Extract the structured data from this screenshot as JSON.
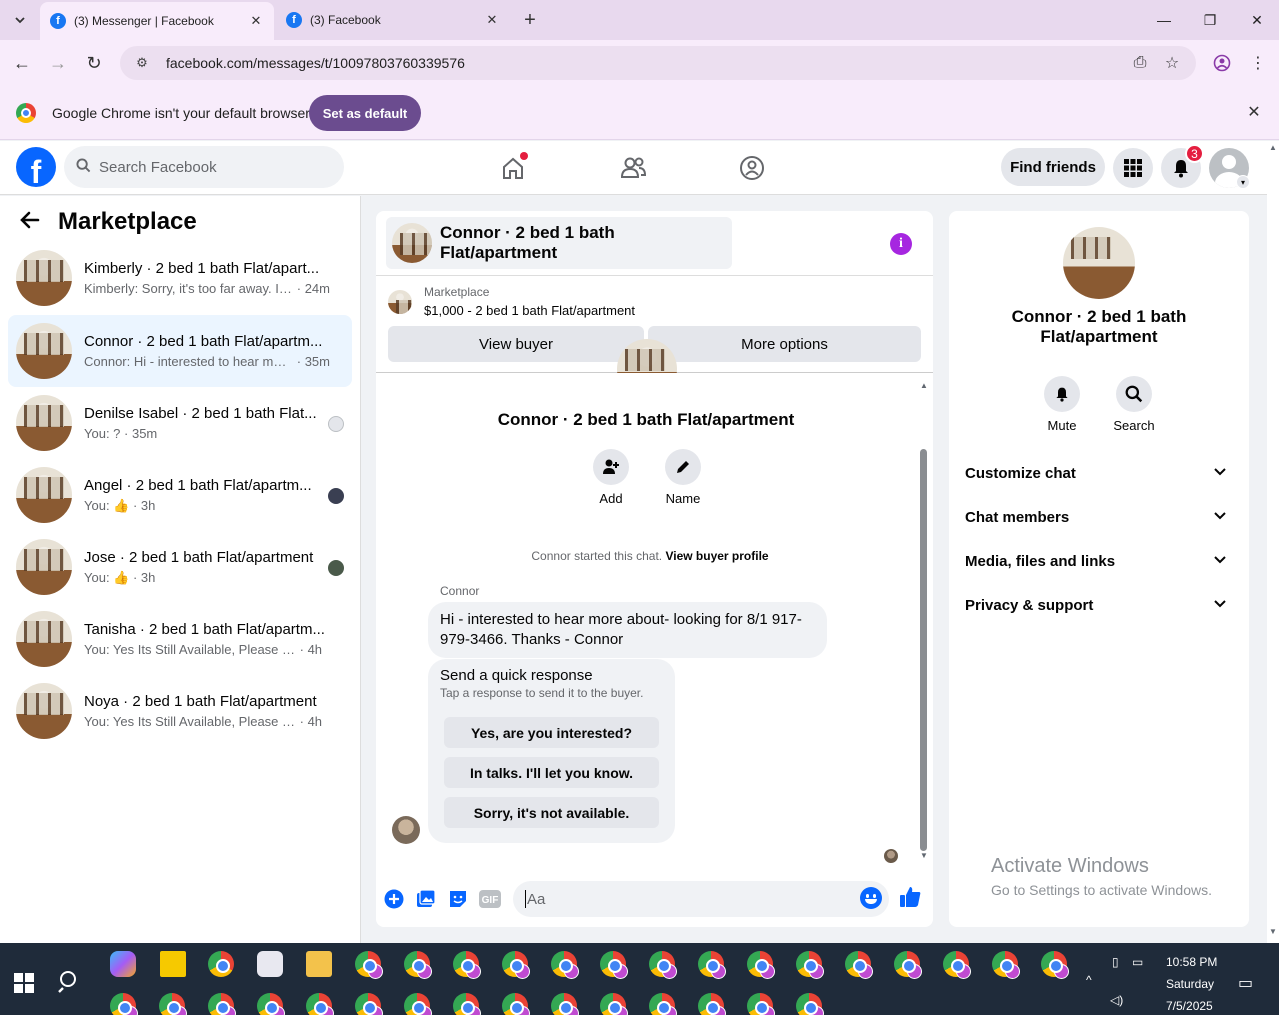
{
  "browser": {
    "tabs": [
      {
        "title": "(3) Messenger | Facebook",
        "favicon": "f"
      },
      {
        "title": "(3) Facebook",
        "favicon": "f"
      }
    ],
    "url": "facebook.com/messages/t/10097803760339576",
    "infobar": {
      "text": "Google Chrome isn't your default browser",
      "button": "Set as default"
    }
  },
  "facebook": {
    "logo": "f",
    "search_placeholder": "Search Facebook",
    "find_friends": "Find friends",
    "notification_count": "3"
  },
  "sidebar": {
    "title": "Marketplace",
    "conversations": [
      {
        "name": "Kimberly · 2 bed 1 bath Flat/apart...",
        "preview": "Kimberly: Sorry, it's too far away. I w...",
        "time": "· 24m",
        "selected": false
      },
      {
        "name": "Connor · 2 bed 1 bath Flat/apartm...",
        "preview": "Connor: Hi - interested to hear mor...",
        "time": "· 35m",
        "selected": true
      },
      {
        "name": "Denilse Isabel · 2 bed 1 bath Flat...",
        "preview": "You: ? ·",
        "time": "35m",
        "selected": false
      },
      {
        "name": "Angel · 2 bed 1 bath Flat/apartm...",
        "preview": "You: 👍",
        "time": "· 3h",
        "selected": false
      },
      {
        "name": "Jose · 2 bed 1 bath Flat/apartment",
        "preview": "You: 👍",
        "time": "· 3h",
        "selected": false
      },
      {
        "name": "Tanisha · 2 bed 1 bath Flat/apartm...",
        "preview": "You: Yes Its Still Available, Please Send...",
        "time": "· 4h",
        "selected": false
      },
      {
        "name": "Noya · 2 bed 1 bath Flat/apartment",
        "preview": "You: Yes Its Still Available, Please Send...",
        "time": "· 4h",
        "selected": false
      }
    ]
  },
  "chat": {
    "header_name": "Connor · 2 bed 1 bath Flat/apartment",
    "listing_label": "Marketplace",
    "listing_title": "$1,000 - 2 bed 1 bath Flat/apartment",
    "view_buyer": "View buyer",
    "more_options": "More options",
    "title": "Connor · 2 bed 1 bath Flat/apartment",
    "add_label": "Add",
    "name_label": "Name",
    "started_text": "Connor started this chat.",
    "view_buyer_profile": "View buyer profile",
    "sender": "Connor",
    "message": "Hi - interested to hear more about- looking for 8/1 917-979-3466. Thanks - Connor",
    "quick_title": "Send a quick response",
    "quick_subtitle": "Tap a response to send it to the buyer.",
    "quick_responses": [
      "Yes, are you interested?",
      "In talks. I'll let you know.",
      "Sorry, it's not available."
    ],
    "composer_placeholder": "Aa",
    "gif_label": "GIF"
  },
  "right_panel": {
    "name": "Connor · 2 bed 1 bath Flat/apartment",
    "mute": "Mute",
    "search": "Search",
    "sections": [
      "Customize chat",
      "Chat members",
      "Media, files and links",
      "Privacy & support"
    ]
  },
  "watermark": {
    "line1": "Activate Windows",
    "line2": "Go to Settings to activate Windows."
  },
  "taskbar": {
    "time": "10:58 PM",
    "day": "Saturday",
    "date": "7/5/2025"
  }
}
